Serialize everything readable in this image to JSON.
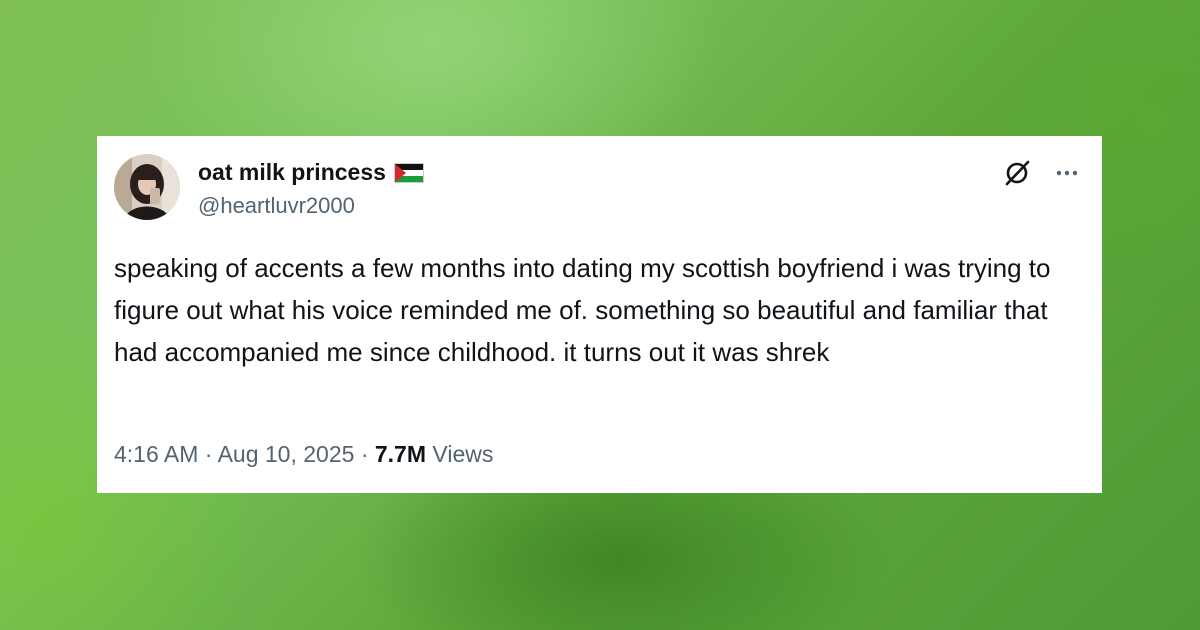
{
  "tweet": {
    "author": {
      "display_name": "oat milk princess",
      "badge": "palestine-flag-emoji",
      "handle": "@heartluvr2000",
      "avatar_icon": "profile-photo"
    },
    "text": "speaking of accents a few months into dating my scottish boyfriend i was trying to figure out what his voice reminded me of. something so beautiful and familiar that had accompanied me since childhood. it turns out it was shrek",
    "time": "4:16 AM",
    "separator": "·",
    "date": "Aug 10, 2025",
    "views_count": "7.7M",
    "views_label": "Views",
    "actions": {
      "grok_icon": "slashed-circle-icon",
      "more_icon": "more-dots-icon"
    }
  },
  "colors": {
    "background_green": "#6cb34a",
    "card": "#ffffff",
    "text_primary": "#0f1419",
    "text_secondary": "#536471"
  }
}
